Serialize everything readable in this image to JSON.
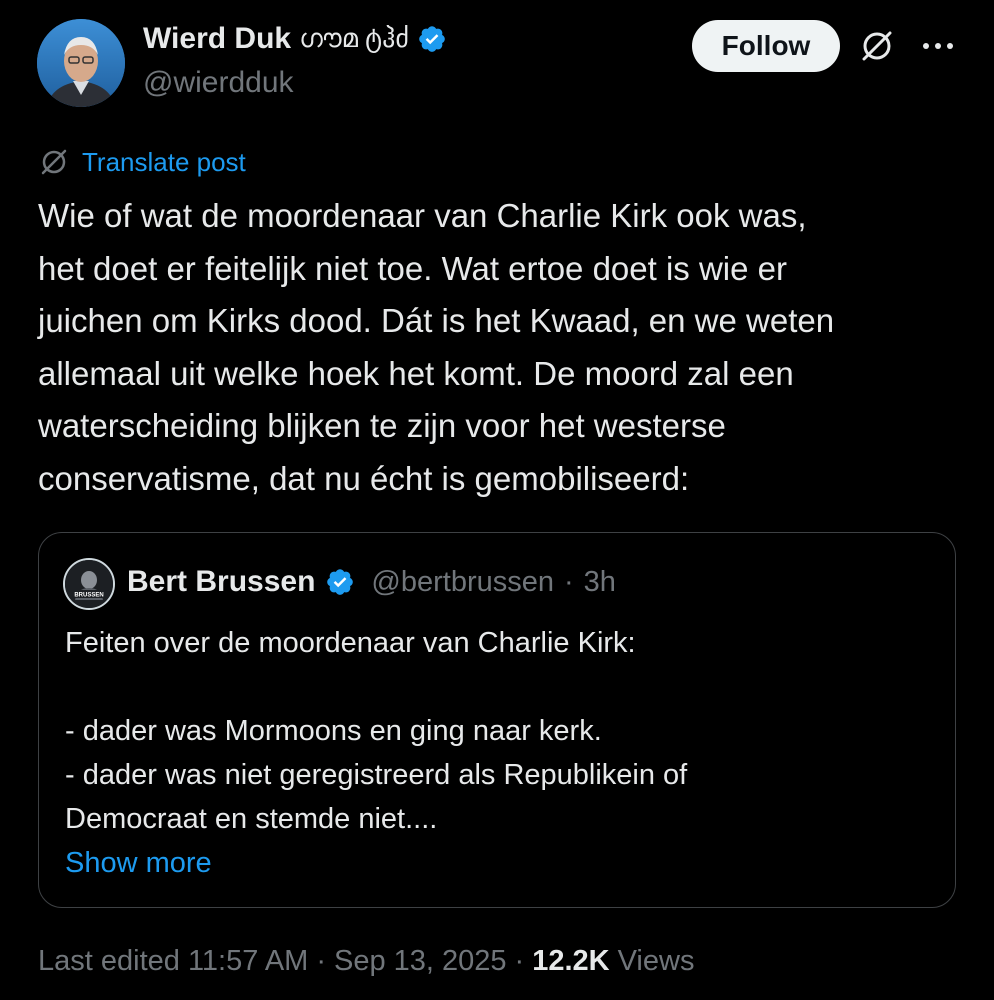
{
  "author": {
    "display_name": "Wierd Duk",
    "name_decoration": "ഗൗമ ტჰძ",
    "handle": "@wierdduk",
    "verified": true
  },
  "actions": {
    "follow_label": "Follow",
    "grok_icon": "grok-icon",
    "more_icon": "more-icon"
  },
  "translate_label": "Translate post",
  "post_text": "Wie of wat de moordenaar van Charlie Kirk ook was,\nhet doet er feitelijk niet toe. Wat ertoe doet is wie er\njuichen om Kirks dood. Dát is het Kwaad, en we weten\nallemaal uit welke hoek het komt. De moord zal een\nwaterscheiding blijken te zijn voor het westerse\nconservatisme, dat nu écht is gemobiliseerd:",
  "quote": {
    "display_name": "Bert Brussen",
    "handle": "@bertbrussen",
    "separator": "·",
    "time": "3h",
    "verified": true,
    "avatar_text": "BRUSSEN",
    "lines": [
      "Feiten over de moordenaar van Charlie Kirk:",
      "",
      "- dader was Mormoons en ging naar kerk.",
      "- dader was niet geregistreerd als Republikein of",
      "Democraat en stemde niet...."
    ],
    "show_more": "Show more"
  },
  "meta": {
    "edited_label": "Last edited 11:57 AM",
    "separator": "·",
    "date": "Sep 13, 2025",
    "views_count": "12.2K",
    "views_label": "Views"
  },
  "colors": {
    "background": "#000000",
    "text": "#e7e9ea",
    "muted": "#71767b",
    "accent": "#1d9bf0",
    "border": "#3e4144"
  }
}
